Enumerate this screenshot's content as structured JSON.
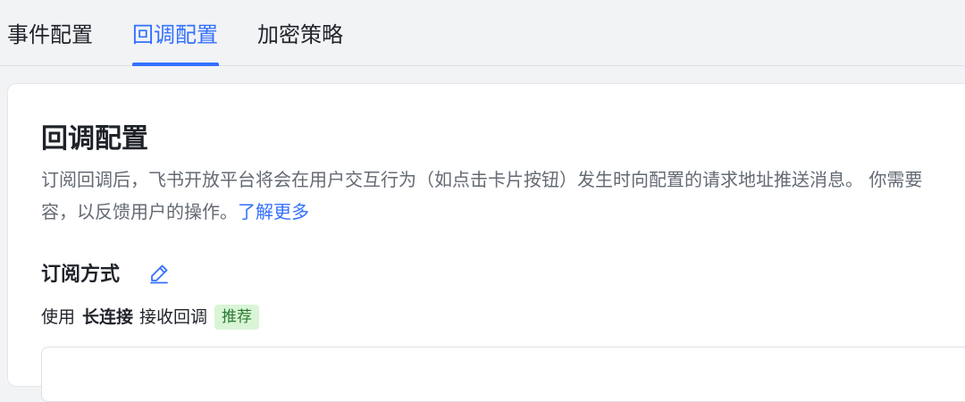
{
  "tabs": [
    {
      "label": "事件配置",
      "active": false
    },
    {
      "label": "回调配置",
      "active": true
    },
    {
      "label": "加密策略",
      "active": false
    }
  ],
  "section": {
    "title": "回调配置",
    "description_line1": "订阅回调后，飞书开放平台将会在用户交互行为（如点击卡片按钮）发生时向配置的请求地址推送消息。 你需要",
    "description_line2_prefix": "容，以反馈用户的操作。",
    "learn_more": "了解更多"
  },
  "subscription": {
    "label": "订阅方式",
    "edit_icon": "pencil-icon",
    "prefix": "使用",
    "method": "长连接",
    "suffix": "接收回调",
    "badge": "推荐"
  },
  "colors": {
    "accent": "#3370ff",
    "badge_bg": "#d9f5d6",
    "badge_text": "#2a7a32"
  }
}
